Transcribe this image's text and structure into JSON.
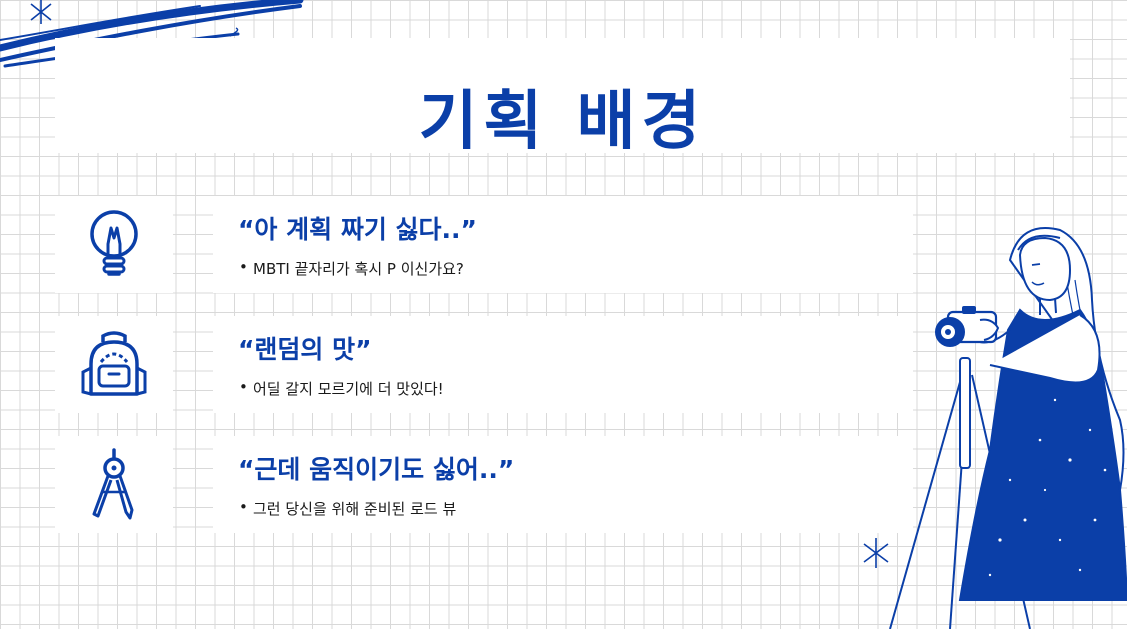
{
  "title": "기획 배경",
  "items": [
    {
      "icon": "lightbulb-icon",
      "heading": "“아 계획 짜기 싫다..”",
      "bullet": "MBTI 끝자리가 혹시 P 이신가요?"
    },
    {
      "icon": "backpack-icon",
      "heading": "“랜덤의 맛”",
      "bullet": "어딜 갈지 모르기에 더 맛있다!"
    },
    {
      "icon": "compass-icon",
      "heading": "“근데 움직이기도 싫어..”",
      "bullet": "그런 당신을 위해 준비된 로드 뷰"
    }
  ],
  "colors": {
    "accent": "#0b3fa8",
    "text": "#1a1a1a",
    "grid": "#d9d9d9"
  }
}
